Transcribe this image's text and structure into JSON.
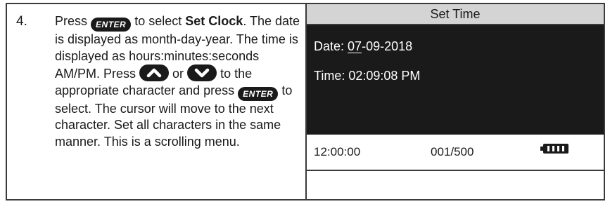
{
  "instruction": {
    "step_number": "4.",
    "press_1": "Press",
    "enter_key": "ENTER",
    "to_select": "to select",
    "set_clock": "Set Clock",
    "period": ".",
    "text_2": "The date is displayed as month-day-year. The time is displayed as hours:minutes:seconds AM/PM. Press",
    "or": "or",
    "to_appropriate": "to the appropriate character and press",
    "text_3": "to select. The cursor will move to the next character. Set all characters in the same manner. This is a scrolling menu."
  },
  "screen": {
    "title": "Set Time",
    "date_label": "Date:",
    "date_month": "07",
    "date_rest": "-09-2018",
    "time_label": "Time:",
    "time_value": "02:09:08 PM",
    "status_time": "12:00:00",
    "status_count": "001/500",
    "battery_icon": "battery-full-icon"
  },
  "colors": {
    "screen_bg": "#1a1a1a",
    "header_bg": "#d4d4d4",
    "text": "#1a1a1a"
  }
}
